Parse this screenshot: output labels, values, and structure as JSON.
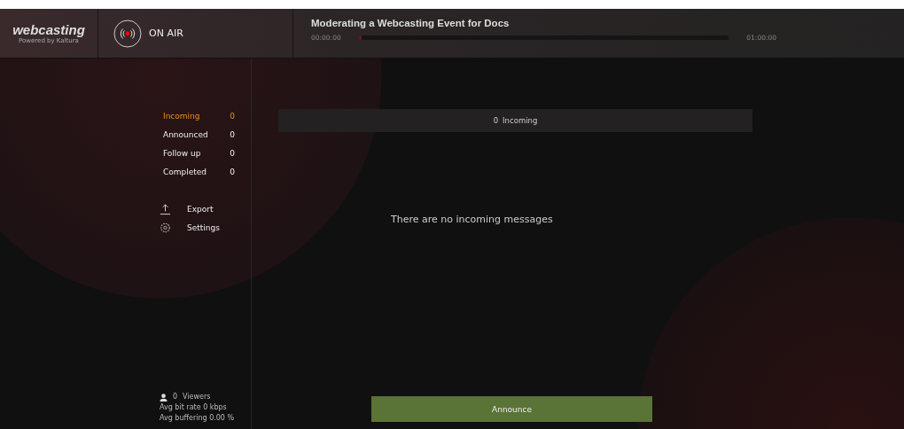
{
  "header": {
    "logo": "webcasting",
    "logo_subtitle": "Powered by Kaltura",
    "status": "ON AIR",
    "title": "Moderating a Webcasting Event for Docs",
    "time_start": "00:00:00",
    "time_end": "01:00:00",
    "level": 0
  },
  "filters": [
    {
      "label": "Incoming",
      "count": "0",
      "selected": true
    },
    {
      "label": "Announced",
      "count": "0",
      "selected": false
    },
    {
      "label": "Follow up",
      "count": "0",
      "selected": false
    },
    {
      "label": "Completed",
      "count": "0",
      "selected": false
    }
  ],
  "actions": [
    {
      "kind": "export",
      "label": "Export"
    },
    {
      "kind": "settings",
      "label": "Settings"
    }
  ],
  "stats": {
    "viewers_count": "0",
    "viewers_label": "Viewers",
    "bitrate": "Avg bit rate 0 kbps",
    "buffering": "Avg buffering 0.00 %"
  },
  "list_header": {
    "count": "0",
    "label": "Incoming"
  },
  "empty_message": "There are no incoming messages",
  "announce_button": "Announce"
}
